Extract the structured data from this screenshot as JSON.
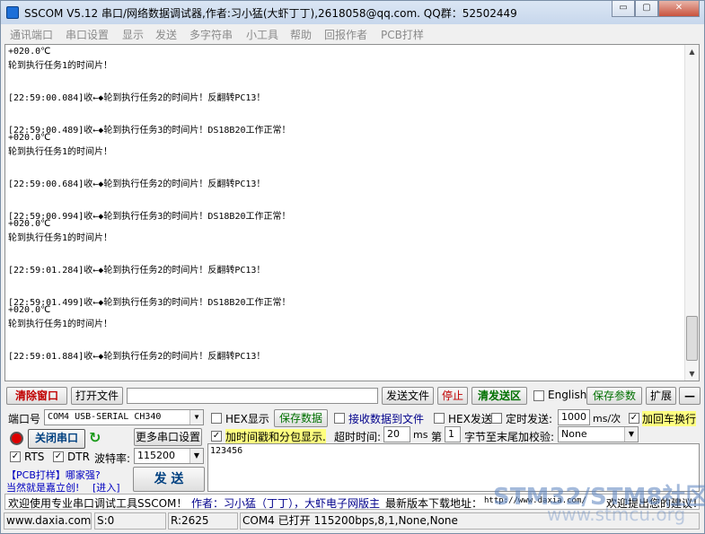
{
  "window": {
    "title": "SSCOM V5.12 串口/网络数据调试器,作者:习小猛(大虾丁丁),2618058@qq.com. QQ群：52502449",
    "min": "▭",
    "max": "▢",
    "close": "✕"
  },
  "menu": [
    "通讯端口",
    "串口设置",
    "显示",
    "发送",
    "多字符串",
    "小工具",
    "帮助",
    "回报作者",
    "PCB打样"
  ],
  "receive_lines": [
    "+020.0℃",
    "轮到执行任务1的时间片！",
    "",
    "",
    "[22:59:00.084]收←◆轮到执行任务2的时间片！反翻转PC13！",
    "",
    "",
    "[22:59:00.489]收←◆轮到执行任务3的时间片！DS18B20工作正常！",
    "+020.0℃",
    "轮到执行任务1的时间片！",
    "",
    "",
    "[22:59:00.684]收←◆轮到执行任务2的时间片！反翻转PC13！",
    "",
    "",
    "[22:59:00.994]收←◆轮到执行任务3的时间片！DS18B20工作正常！",
    "+020.0℃",
    "轮到执行任务1的时间片！",
    "",
    "",
    "[22:59:01.284]收←◆轮到执行任务2的时间片！反翻转PC13！",
    "",
    "",
    "[22:59:01.499]收←◆轮到执行任务3的时间片！DS18B20工作正常！",
    "+020.0℃",
    "轮到执行任务1的时间片！",
    "",
    "",
    "[22:59:01.884]收←◆轮到执行任务2的时间片！反翻转PC13！"
  ],
  "toolbar": {
    "clear": "清除窗口",
    "open_file": "打开文件",
    "file_path": "",
    "send_file": "发送文件",
    "stop": "停止",
    "clear_send": "清发送区",
    "english": "English",
    "save_params": "保存参数",
    "expand": "扩展",
    "dash": "—"
  },
  "port": {
    "label": "端口号",
    "value": "COM4 USB-SERIAL CH340",
    "close_btn": "关闭串口",
    "more_settings": "更多串口设置",
    "rts": "RTS",
    "dtr": "DTR",
    "baud_label": "波特率:",
    "baud": "115200"
  },
  "options": {
    "hex_display": "HEX显示",
    "save_data": "保存数据",
    "recv_to_file": "接收数据到文件",
    "hex_send": "HEX发送",
    "timed_send": "定时发送:",
    "interval": "1000",
    "interval_unit": "ms/次",
    "add_crlf": "加回车换行",
    "timestamp": "加时间戳和分包显示.",
    "timeout_label": "超时时间:",
    "timeout": "20",
    "timeout_unit": "ms",
    "byte_prefix": "第",
    "byte_num": "1",
    "byte_suffix": "字节至末尾加校验:",
    "checksum": "None"
  },
  "promo": {
    "line1": "【PCB打样】哪家强?",
    "line2": "当然就是嘉立创!",
    "enter": "[进入]",
    "send": "发 送"
  },
  "send_text": "123456",
  "info": {
    "text1": "欢迎使用专业串口调试工具SSCOM！",
    "text2": "作者：习小猛（丁丁），大虾电子网版主",
    "text3": "最新版本下载地址：",
    "url": "http://www.daxia.com/",
    "text4": "欢迎提出您的建议！"
  },
  "status": {
    "site": "www.daxia.com",
    "s": "S:0",
    "r": "R:2625",
    "port_state": "COM4 已打开  115200bps,8,1,None,None"
  },
  "watermark": {
    "line1": "STM32/STM8社区",
    "line2": "www.stmcu.org"
  }
}
